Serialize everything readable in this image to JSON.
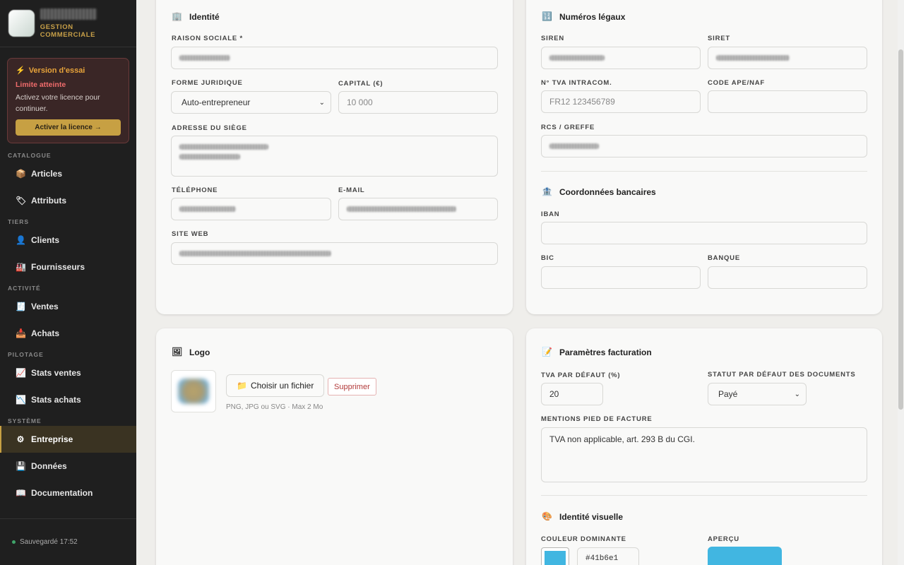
{
  "brand": {
    "name": "",
    "subtitle": "GESTION COMMERCIALE"
  },
  "trial": {
    "title": "Version d'essai",
    "limit": "Limite atteinte",
    "desc": "Activez votre licence pour continuer.",
    "button": "Activer la licence →"
  },
  "nav": {
    "catalogue": "CATALOGUE",
    "articles": "Articles",
    "attributs": "Attributs",
    "tiers": "TIERS",
    "clients": "Clients",
    "fournisseurs": "Fournisseurs",
    "activite": "ACTIVITÉ",
    "ventes": "Ventes",
    "achats": "Achats",
    "pilotage": "PILOTAGE",
    "stats_ventes": "Stats ventes",
    "stats_achats": "Stats achats",
    "systeme": "SYSTÈME",
    "entreprise": "Entreprise",
    "donnees": "Données",
    "documentation": "Documentation"
  },
  "footer": {
    "saved": "Sauvegardé 17:52"
  },
  "identite": {
    "title": "Identité",
    "raison_sociale_label": "RAISON SOCIALE *",
    "forme_juridique_label": "FORME JURIDIQUE",
    "forme_juridique_value": "Auto-entrepreneur",
    "capital_label": "CAPITAL (€)",
    "capital_placeholder": "10 000",
    "adresse_label": "ADRESSE DU SIÈGE",
    "telephone_label": "TÉLÉPHONE",
    "email_label": "E-MAIL",
    "site_label": "SITE WEB"
  },
  "legaux": {
    "title": "Numéros légaux",
    "siren_label": "SIREN",
    "siret_label": "SIRET",
    "tva_label": "N° TVA INTRACOM.",
    "tva_placeholder": "FR12 123456789",
    "ape_label": "CODE APE/NAF",
    "rcs_label": "RCS / GREFFE"
  },
  "banque": {
    "title": "Coordonnées bancaires",
    "iban_label": "IBAN",
    "bic_label": "BIC",
    "banque_label": "BANQUE"
  },
  "logo": {
    "title": "Logo",
    "choose": "Choisir un fichier",
    "delete": "Supprimer",
    "hint": "PNG, JPG ou SVG · Max 2 Mo"
  },
  "facturation": {
    "title": "Paramètres facturation",
    "tva_label": "TVA PAR DÉFAUT (%)",
    "tva_value": "20",
    "statut_label": "STATUT PAR DÉFAUT DES DOCUMENTS",
    "statut_value": "Payé",
    "mentions_label": "MENTIONS PIED DE FACTURE",
    "mentions_value": "TVA non applicable, art. 293 B du CGI."
  },
  "visuel": {
    "title": "Identité visuelle",
    "couleur_label": "COULEUR DOMINANTE",
    "couleur_value": "#41b6e1",
    "apercu_label": "APERÇU"
  }
}
